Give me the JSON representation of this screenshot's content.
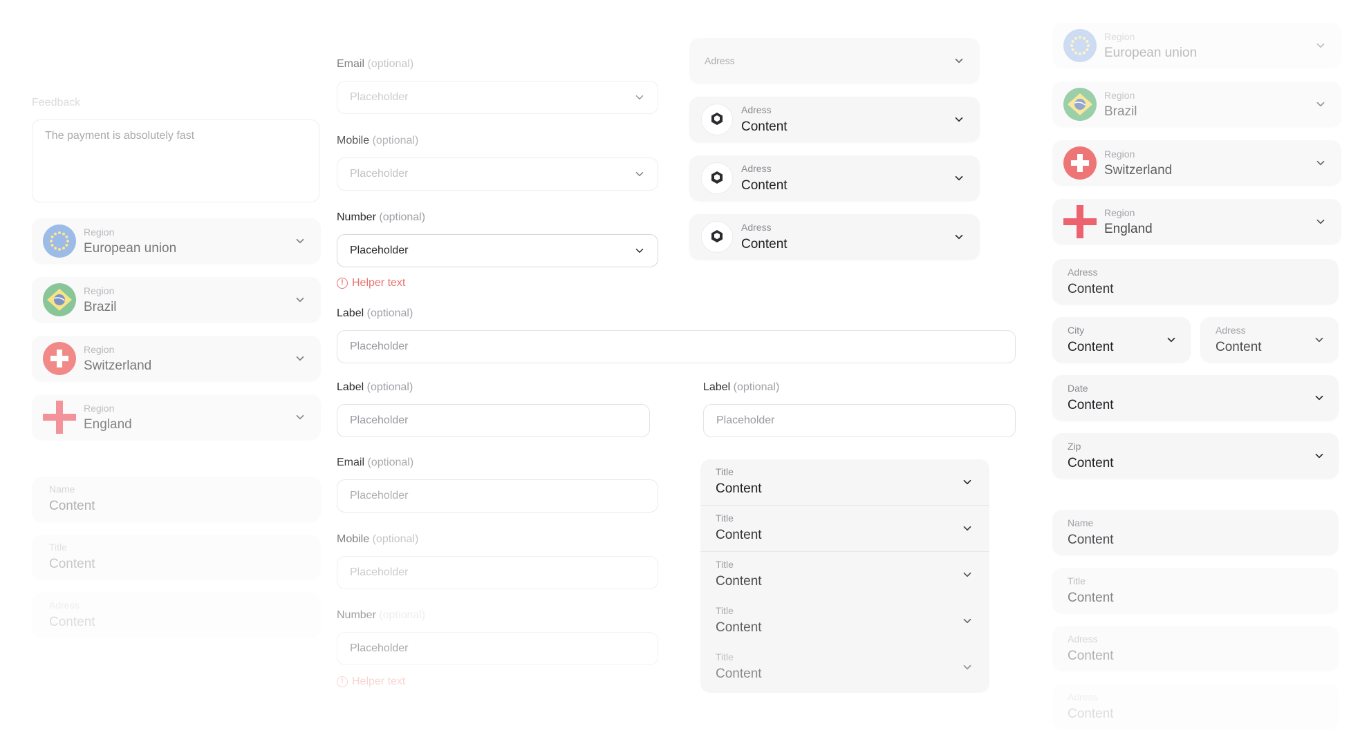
{
  "col1": {
    "feedback": {
      "label": "Feedback",
      "value": "The payment is absolutely fast"
    },
    "regions": [
      {
        "label": "Region",
        "value": "European union",
        "flag": "eu-flag-icon"
      },
      {
        "label": "Region",
        "value": "Brazil",
        "flag": "brazil-flag-icon"
      },
      {
        "label": "Region",
        "value": "Switzerland",
        "flag": "swiss-flag-icon"
      },
      {
        "label": "Region",
        "value": "England",
        "flag": "england-flag-icon"
      }
    ],
    "plain": [
      {
        "label": "Name",
        "value": "Content"
      },
      {
        "label": "Title",
        "value": "Content"
      },
      {
        "label": "Adress",
        "value": "Content"
      }
    ]
  },
  "col2": {
    "selects": [
      {
        "label": "Email",
        "optional": "(optional)",
        "placeholder": "Placeholder"
      },
      {
        "label": "Mobile",
        "optional": "(optional)",
        "placeholder": "Placeholder"
      },
      {
        "label": "Number",
        "optional": "(optional)",
        "placeholder": "Placeholder"
      }
    ],
    "helper_top": "Helper text",
    "wide": {
      "label": "Label",
      "optional": "(optional)",
      "placeholder": "Placeholder"
    },
    "half_left": {
      "label": "Label",
      "optional": "(optional)",
      "placeholder": "Placeholder"
    },
    "half_right": {
      "label": "Label",
      "optional": "(optional)",
      "placeholder": "Placeholder"
    },
    "inputs": [
      {
        "label": "Email",
        "optional": "(optional)",
        "placeholder": "Placeholder"
      },
      {
        "label": "Mobile",
        "optional": "(optional)",
        "placeholder": "Placeholder"
      },
      {
        "label": "Number",
        "optional": "(optional)",
        "placeholder": "Placeholder"
      }
    ],
    "helper_bottom": "Helper text"
  },
  "col3": {
    "address_empty": {
      "placeholder": "Adress"
    },
    "address_rows": [
      {
        "label": "Adress",
        "value": "Content"
      },
      {
        "label": "Adress",
        "value": "Content"
      },
      {
        "label": "Adress",
        "value": "Content"
      }
    ],
    "title_list": [
      {
        "label": "Title",
        "value": "Content"
      },
      {
        "label": "Title",
        "value": "Content"
      },
      {
        "label": "Title",
        "value": "Content"
      },
      {
        "label": "Title",
        "value": "Content"
      },
      {
        "label": "Title",
        "value": "Content"
      }
    ]
  },
  "col4": {
    "regions": [
      {
        "label": "Region",
        "value": "European union"
      },
      {
        "label": "Region",
        "value": "Brazil"
      },
      {
        "label": "Region",
        "value": "Switzerland"
      },
      {
        "label": "Region",
        "value": "England"
      }
    ],
    "address": {
      "label": "Adress",
      "value": "Content"
    },
    "city": {
      "label": "City",
      "value": "Content"
    },
    "address2": {
      "label": "Adress",
      "value": "Content"
    },
    "date": {
      "label": "Date",
      "value": "Content"
    },
    "zip": {
      "label": "Zip",
      "value": "Content"
    },
    "plain": [
      {
        "label": "Name",
        "value": "Content"
      },
      {
        "label": "Title",
        "value": "Content"
      },
      {
        "label": "Adress",
        "value": "Content"
      },
      {
        "label": "Adress",
        "value": "Content"
      }
    ]
  },
  "colors": {
    "accent_error": "#e8736f",
    "card_bg": "#f6f6f7",
    "border": "#e3e3e6"
  }
}
